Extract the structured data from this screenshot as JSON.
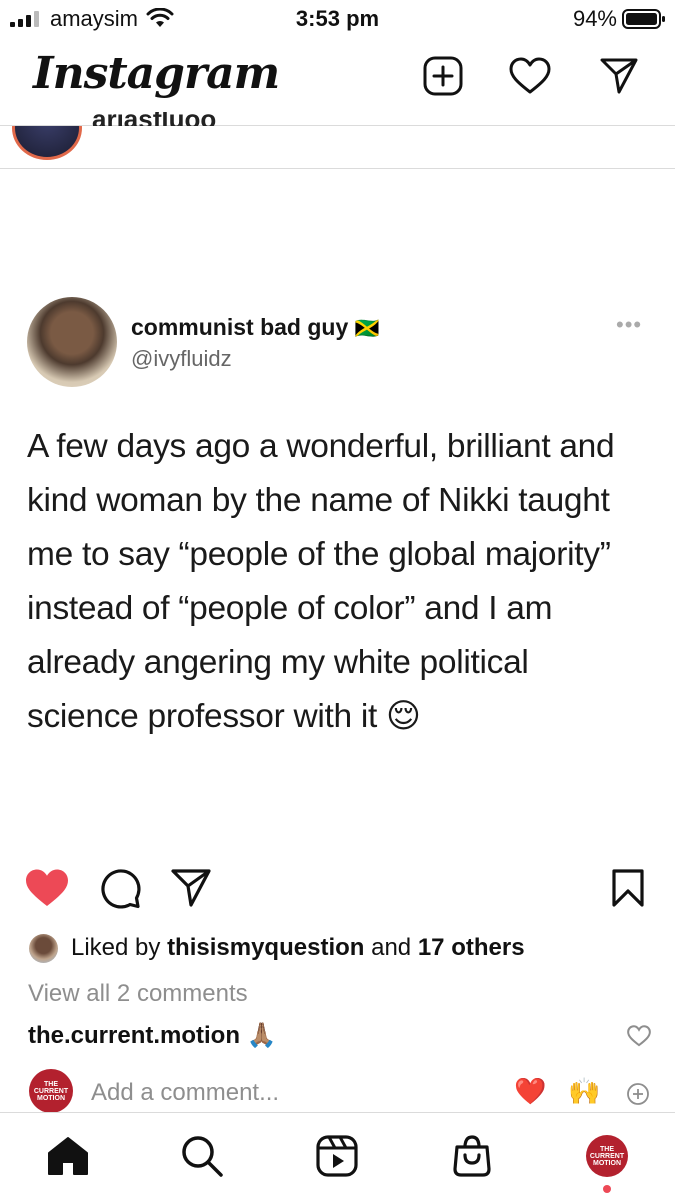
{
  "status_bar": {
    "carrier": "amaysim",
    "time": "3:53 pm",
    "battery": "94%"
  },
  "header": {
    "logo": "Instagram",
    "icons": [
      "new-post-icon",
      "heart-icon",
      "direct-message-icon"
    ]
  },
  "story_row": {
    "username_cut": "ariasfluoo"
  },
  "post": {
    "tweet": {
      "display_name": "communist bad guy",
      "flag": "🇯🇲",
      "handle": "@ivyfluidz",
      "more": "•••",
      "text": "A few days ago a wonderful, brilliant and kind woman by the name of Nikki taught me to say “people of the global majority” instead of “people of color” and I am already angering my white political science professor with it 😌"
    },
    "actions": {
      "like_color": "#ed4956",
      "icons": [
        "heart-filled-icon",
        "comment-icon",
        "share-icon",
        "bookmark-icon"
      ]
    },
    "likes": {
      "prefix": "Liked by ",
      "user": "thisismyquestion",
      "middle": " and ",
      "others": "17 others"
    },
    "view_comments": "View all 2 comments",
    "top_comment": {
      "user": "the.current.motion",
      "text": "🙏🏽"
    },
    "add_comment": {
      "placeholder": "Add a comment...",
      "quick_emojis": [
        "❤️",
        "🙌"
      ]
    },
    "badge_text": [
      "THE",
      "CURRENT",
      "MOTION"
    ]
  },
  "tab_bar": {
    "items": [
      "home-icon",
      "search-icon",
      "reels-icon",
      "shop-icon",
      "profile-avatar"
    ]
  }
}
